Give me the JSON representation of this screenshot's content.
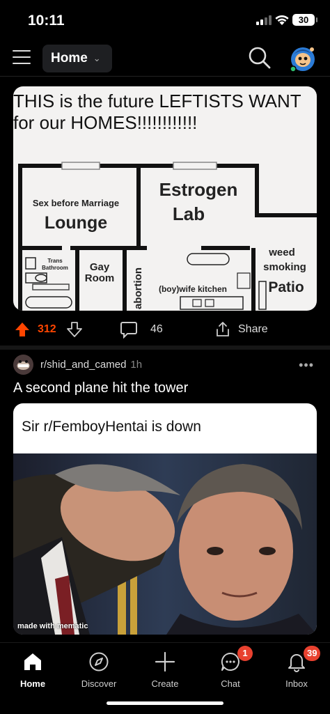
{
  "status_bar": {
    "time": "10:11",
    "battery": "30"
  },
  "top_nav": {
    "feed_label": "Home"
  },
  "post1": {
    "image_text": {
      "headline": "THIS is the future LEFTISTS WANT for our HOMES!!!!!!!!!!!!",
      "rooms": {
        "lounge_small": "Sex before Marriage",
        "lounge": "Lounge",
        "lab_1": "Estrogen",
        "lab_2": "Lab",
        "bath_1": "Trans",
        "bath_2": "Bathroom",
        "gay_1": "Gay",
        "gay_2": "Room",
        "abortion": "abortion",
        "kitchen": "(boy)wife kitchen",
        "patio_1": "weed",
        "patio_2": "smoking",
        "patio_3": "Patio"
      }
    },
    "votes": "312",
    "comments": "46",
    "share_label": "Share"
  },
  "post2": {
    "subreddit": "r/shid_and_camed",
    "time": "1h",
    "title": "A second plane hit the tower",
    "image_caption": "Sir r/FemboyHentai is down",
    "watermark": "made with mematic"
  },
  "tab_bar": {
    "tabs": [
      {
        "label": "Home",
        "icon": "home-icon"
      },
      {
        "label": "Discover",
        "icon": "compass-icon"
      },
      {
        "label": "Create",
        "icon": "plus-icon"
      },
      {
        "label": "Chat",
        "icon": "chat-icon",
        "badge": "1"
      },
      {
        "label": "Inbox",
        "icon": "bell-icon",
        "badge": "39"
      }
    ]
  },
  "colors": {
    "upvote": "#ff4500",
    "badge": "#e8412f",
    "background": "#000000"
  }
}
